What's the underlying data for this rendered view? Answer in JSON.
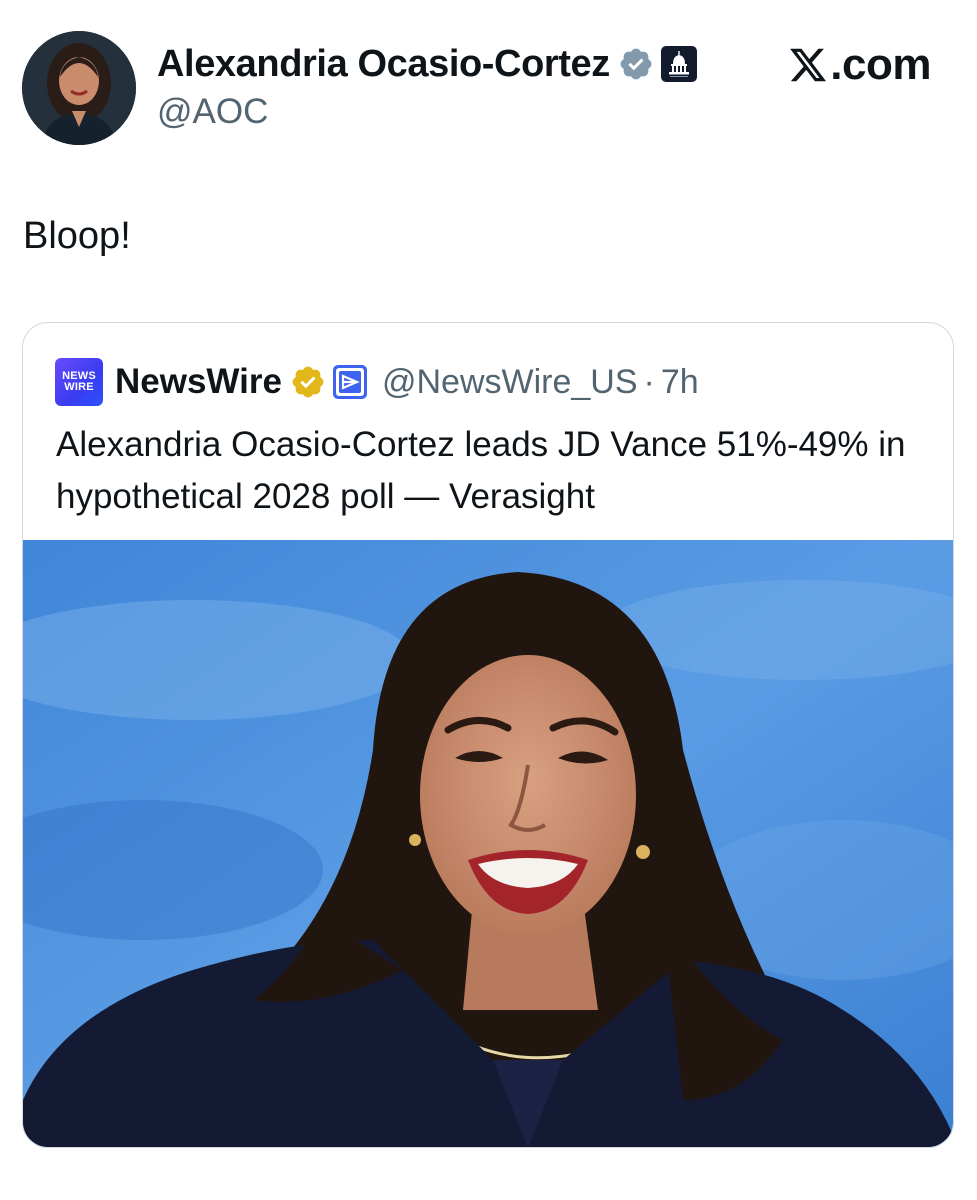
{
  "tweet": {
    "author": {
      "display_name": "Alexandria Ocasio-Cortez",
      "handle": "@AOC",
      "verified_badge": "verified-badge-icon",
      "affiliation_badge": "capitol-icon"
    },
    "site_logo": {
      "icon": "x-logo-icon",
      "text": ".com"
    },
    "text": "Bloop!"
  },
  "quote": {
    "author": {
      "logo_line1": "NEWS",
      "logo_line2": "WIRE",
      "display_name": "NewsWire",
      "handle": "@NewsWire_US",
      "separator": "·",
      "time": "7h",
      "verified_badge": "gold-verified-badge-icon",
      "affiliation_badge": "affiliate-badge-icon"
    },
    "text": "Alexandria Ocasio-Cortez leads JD Vance 51%-49% in hypothetical 2028 poll — Verasight",
    "image": {
      "icon": "news-photo"
    }
  },
  "colors": {
    "text_primary": "#0f1419",
    "text_secondary": "#536471",
    "card_border": "#cfd9de",
    "grey_verified": "#829aab",
    "gold_verified": "#e2b719",
    "newswire_purple": "#5b42f3",
    "photo_background": "#4a8fdc"
  }
}
